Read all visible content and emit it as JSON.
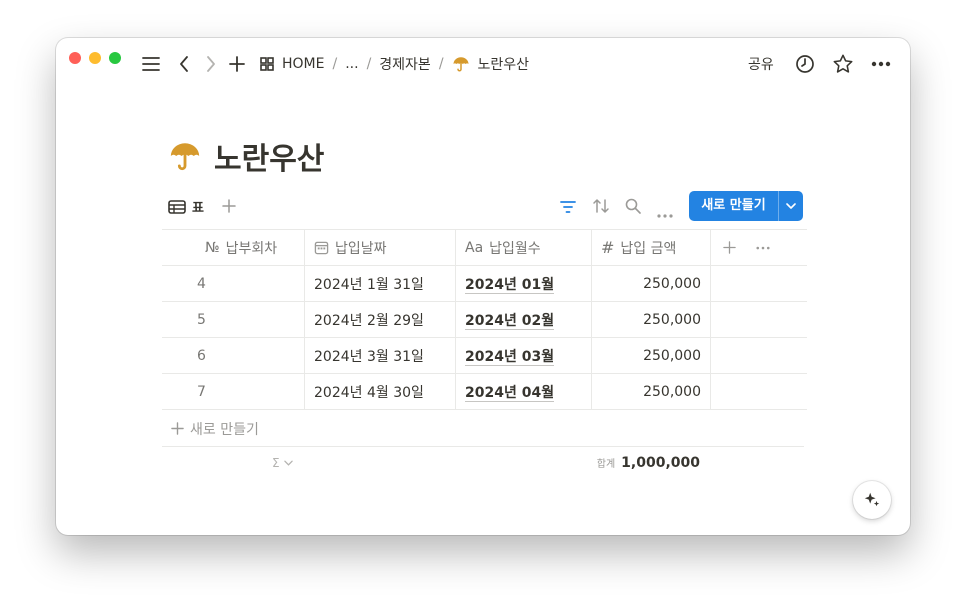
{
  "topbar": {
    "breadcrumb": [
      "HOME",
      "...",
      "경제자본",
      "노란우산"
    ],
    "share_label": "공유"
  },
  "page": {
    "title": "노란우산",
    "icon": "umbrella-icon"
  },
  "viewbar": {
    "view_label": "표",
    "new_button_label": "새로 만들기"
  },
  "table": {
    "columns": [
      {
        "label": "납부회차",
        "icon": "number-icon"
      },
      {
        "label": "납입날짜",
        "icon": "calendar-icon"
      },
      {
        "label": "납입월수",
        "icon": "text-icon"
      },
      {
        "label": "납입 금액",
        "icon": "hash-icon"
      }
    ],
    "column_icon_text": {
      "no": "№",
      "title": "Aa",
      "hash": "#"
    },
    "rows": [
      {
        "no": "4",
        "date": "2024년 1월 31일",
        "month": "2024년 01월",
        "amount": "250,000"
      },
      {
        "no": "5",
        "date": "2024년 2월 29일",
        "month": "2024년 02월",
        "amount": "250,000"
      },
      {
        "no": "6",
        "date": "2024년 3월 31일",
        "month": "2024년 03월",
        "amount": "250,000"
      },
      {
        "no": "7",
        "date": "2024년 4월 30일",
        "month": "2024년 04월",
        "amount": "250,000"
      }
    ],
    "new_row_label": "새로 만들기",
    "sum_label": "합계",
    "sum_value": "1,000,000",
    "calc_symbol": "Σ"
  },
  "colors": {
    "accent": "#2383e2",
    "umbrella": "#d69a2d"
  }
}
